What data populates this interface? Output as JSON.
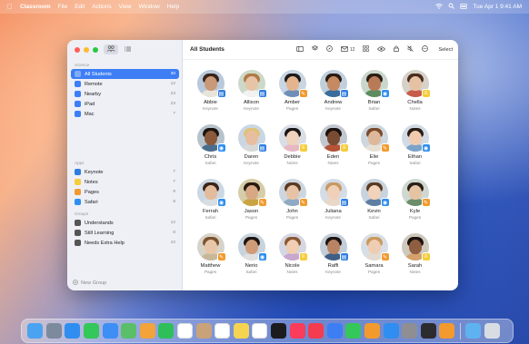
{
  "menubar": {
    "app_name": "Classroom",
    "menus": [
      "File",
      "Edit",
      "Actions",
      "View",
      "Window",
      "Help"
    ],
    "clock": "Tue Apr 1  9:41 AM"
  },
  "sidebar": {
    "sections": [
      {
        "header": "Science",
        "items": [
          {
            "label": "All Students",
            "count": "30",
            "icon": "people-icon",
            "color": "#8e8e93",
            "selected": true
          },
          {
            "label": "Remote",
            "count": "12",
            "icon": "remote-icon",
            "color": "#3d7ef5"
          },
          {
            "label": "Nearby",
            "count": "23",
            "icon": "nearby-icon",
            "color": "#3d7ef5"
          },
          {
            "label": "iPad",
            "count": "23",
            "icon": "ipad-icon",
            "color": "#3d7ef5"
          },
          {
            "label": "Mac",
            "count": "7",
            "icon": "mac-icon",
            "color": "#3d7ef5"
          }
        ]
      },
      {
        "header": "Apps",
        "items": [
          {
            "label": "Keynote",
            "count": "7",
            "icon": "keynote-icon",
            "color": "#2f7de1"
          },
          {
            "label": "Notes",
            "count": "7",
            "icon": "notes-icon",
            "color": "#f5cd3a"
          },
          {
            "label": "Pages",
            "count": "8",
            "icon": "pages-icon",
            "color": "#f29a2e"
          },
          {
            "label": "Safari",
            "count": "8",
            "icon": "safari-icon",
            "color": "#2f8ef0"
          }
        ]
      },
      {
        "header": "Groups",
        "items": [
          {
            "label": "Understands",
            "count": "12",
            "icon": "group-icon",
            "color": "#555"
          },
          {
            "label": "Still Learning",
            "count": "8",
            "icon": "group-icon",
            "color": "#555"
          },
          {
            "label": "Needs Extra Help",
            "count": "10",
            "icon": "group-icon",
            "color": "#555"
          }
        ]
      }
    ],
    "new_group": "New Group"
  },
  "toolbar": {
    "title": "All Students",
    "message_count": "12",
    "select_label": "Select"
  },
  "students": [
    {
      "name": "Abbie",
      "app": "Keynote",
      "badge": "#2f7de1",
      "skin": "#c99a78",
      "hair": "#3b2418",
      "shirt": "#e9e4da",
      "bg": "#b8c9dc"
    },
    {
      "name": "Allison",
      "app": "Keynote",
      "badge": "#2f7de1",
      "skin": "#e8c4a6",
      "hair": "#b07a46",
      "shirt": "#f2f2f2",
      "bg": "#cdd9c8"
    },
    {
      "name": "Amber",
      "app": "Pages",
      "badge": "#f29a2e",
      "skin": "#e3b48e",
      "hair": "#1d1a1a",
      "shirt": "#6f8fb8",
      "bg": "#c8d5e3"
    },
    {
      "name": "Andrew",
      "app": "Keynote",
      "badge": "#2f7de1",
      "skin": "#c58a62",
      "hair": "#2a1a12",
      "shirt": "#3a6b9c",
      "bg": "#c1cfdc"
    },
    {
      "name": "Brian",
      "app": "Safari",
      "badge": "#2f8ef0",
      "skin": "#b97b57",
      "hair": "#2b1d14",
      "shirt": "#5b8d5e",
      "bg": "#cad6cc"
    },
    {
      "name": "Chella",
      "app": "Notes",
      "badge": "#f5cd3a",
      "skin": "#e6c2a4",
      "hair": "#4a2d1c",
      "shirt": "#c85c4a",
      "bg": "#d6d1c9"
    },
    {
      "name": "Chris",
      "app": "Safari",
      "badge": "#2f8ef0",
      "skin": "#8b5a3c",
      "hair": "#1c1410",
      "shirt": "#4b6e8e",
      "bg": "#b6c3cc"
    },
    {
      "name": "Daren",
      "app": "Keynote",
      "badge": "#2f7de1",
      "skin": "#e7bfa0",
      "hair": "#e0c27a",
      "shirt": "#d8d8d8",
      "bg": "#c9d7e4"
    },
    {
      "name": "Debbie",
      "app": "Notes",
      "badge": "#f5cd3a",
      "skin": "#efd2bb",
      "hair": "#1a1616",
      "shirt": "#e6b8c2",
      "bg": "#d8dde6"
    },
    {
      "name": "Eden",
      "app": "Notes",
      "badge": "#f5cd3a",
      "skin": "#7a4b33",
      "hair": "#1b1210",
      "shirt": "#b55238",
      "bg": "#c2c7cf"
    },
    {
      "name": "Elie",
      "app": "Pages",
      "badge": "#f29a2e",
      "skin": "#deb89a",
      "hair": "#7a4a2a",
      "shirt": "#e7e1d5",
      "bg": "#ced6de"
    },
    {
      "name": "Ethan",
      "app": "Safari",
      "badge": "#2f8ef0",
      "skin": "#f0cbb0",
      "hair": "#2a1c14",
      "shirt": "#7aa3c8",
      "bg": "#d2dbe5"
    },
    {
      "name": "Ferrah",
      "app": "Safari",
      "badge": "#2f8ef0",
      "skin": "#e2bc9c",
      "hair": "#3b2417",
      "shirt": "#d8dde2",
      "bg": "#cbd8e4"
    },
    {
      "name": "Jason",
      "app": "Pages",
      "badge": "#f29a2e",
      "skin": "#d8a884",
      "hair": "#2a1a10",
      "shirt": "#c9a443",
      "bg": "#d6cda9"
    },
    {
      "name": "John",
      "app": "Pages",
      "badge": "#f29a2e",
      "skin": "#e7c3a6",
      "hair": "#5a3a22",
      "shirt": "#8fa9c4",
      "bg": "#cdd6df"
    },
    {
      "name": "Juliana",
      "app": "Keynote",
      "badge": "#2f7de1",
      "skin": "#f0d0b8",
      "hair": "#c79a63",
      "shirt": "#e9d8c8",
      "bg": "#d4dce6"
    },
    {
      "name": "Kevin",
      "app": "Safari",
      "badge": "#2f8ef0",
      "skin": "#f1d2bb",
      "hair": "#5b3a22",
      "shirt": "#5f7ea3",
      "bg": "#c7d3de"
    },
    {
      "name": "Kyle",
      "app": "Pages",
      "badge": "#f29a2e",
      "skin": "#e6c3a3",
      "hair": "#2b1e16",
      "shirt": "#6b8e6a",
      "bg": "#cfd8d0"
    },
    {
      "name": "Matthew",
      "app": "Pages",
      "badge": "#f29a2e",
      "skin": "#e8c7a9",
      "hair": "#7b5230",
      "shirt": "#c7b89a",
      "bg": "#d8d3c8"
    },
    {
      "name": "Nerio",
      "app": "Safari",
      "badge": "#2f8ef0",
      "skin": "#d09c78",
      "hair": "#1d1410",
      "shirt": "#e0e0e0",
      "bg": "#c8d3dd"
    },
    {
      "name": "Nicole",
      "app": "Notes",
      "badge": "#f5cd3a",
      "skin": "#f0cdb3",
      "hair": "#8a5a34",
      "shirt": "#c8a7d0",
      "bg": "#d5d8e3"
    },
    {
      "name": "Raffi",
      "app": "Keynote",
      "badge": "#2f7de1",
      "skin": "#b98463",
      "hair": "#1e1512",
      "shirt": "#3f5f86",
      "bg": "#c3cdd8"
    },
    {
      "name": "Samara",
      "app": "Pages",
      "badge": "#f29a2e",
      "skin": "#efcdb3",
      "hair": "#c9995e",
      "shirt": "#e3dbd0",
      "bg": "#d8dee5"
    },
    {
      "name": "Sarah",
      "app": "Notes",
      "badge": "#f5cd3a",
      "skin": "#8f5d40",
      "hair": "#1a120e",
      "shirt": "#d4a16a",
      "bg": "#cfc8bd"
    }
  ],
  "dock": [
    {
      "icon": "finder-icon",
      "color": "#4aa3f0"
    },
    {
      "icon": "launchpad-icon",
      "color": "#7c8a9e"
    },
    {
      "icon": "safari-icon",
      "color": "#2f8ef0"
    },
    {
      "icon": "messages-icon",
      "color": "#34c759"
    },
    {
      "icon": "mail-icon",
      "color": "#3d8ef5"
    },
    {
      "icon": "maps-icon",
      "color": "#5bbf6a"
    },
    {
      "icon": "photos-icon",
      "color": "#f2a33a"
    },
    {
      "icon": "facetime-icon",
      "color": "#2fbf5a"
    },
    {
      "icon": "calendar-icon",
      "color": "#ffffff"
    },
    {
      "icon": "contacts-icon",
      "color": "#c9a27a"
    },
    {
      "icon": "reminders-icon",
      "color": "#ffffff"
    },
    {
      "icon": "notes-icon",
      "color": "#f5d451"
    },
    {
      "icon": "freeform-icon",
      "color": "#ffffff"
    },
    {
      "icon": "tv-icon",
      "color": "#1c1c1e"
    },
    {
      "icon": "music-icon",
      "color": "#fb3c5a"
    },
    {
      "icon": "news-icon",
      "color": "#f43b4f"
    },
    {
      "icon": "keynote-icon",
      "color": "#3d7ef5"
    },
    {
      "icon": "numbers-icon",
      "color": "#34c759"
    },
    {
      "icon": "pages-icon",
      "color": "#f29a2e"
    },
    {
      "icon": "appstore-icon",
      "color": "#2f8ef0"
    },
    {
      "icon": "settings-icon",
      "color": "#8e8e93"
    },
    {
      "icon": "iphone-mirroring-icon",
      "color": "#2c2c2e"
    },
    {
      "icon": "classroom-icon",
      "color": "#f29a2e"
    },
    {
      "icon": "downloads-icon",
      "color": "#5fb2f0"
    },
    {
      "icon": "trash-icon",
      "color": "#d8dde3"
    }
  ]
}
